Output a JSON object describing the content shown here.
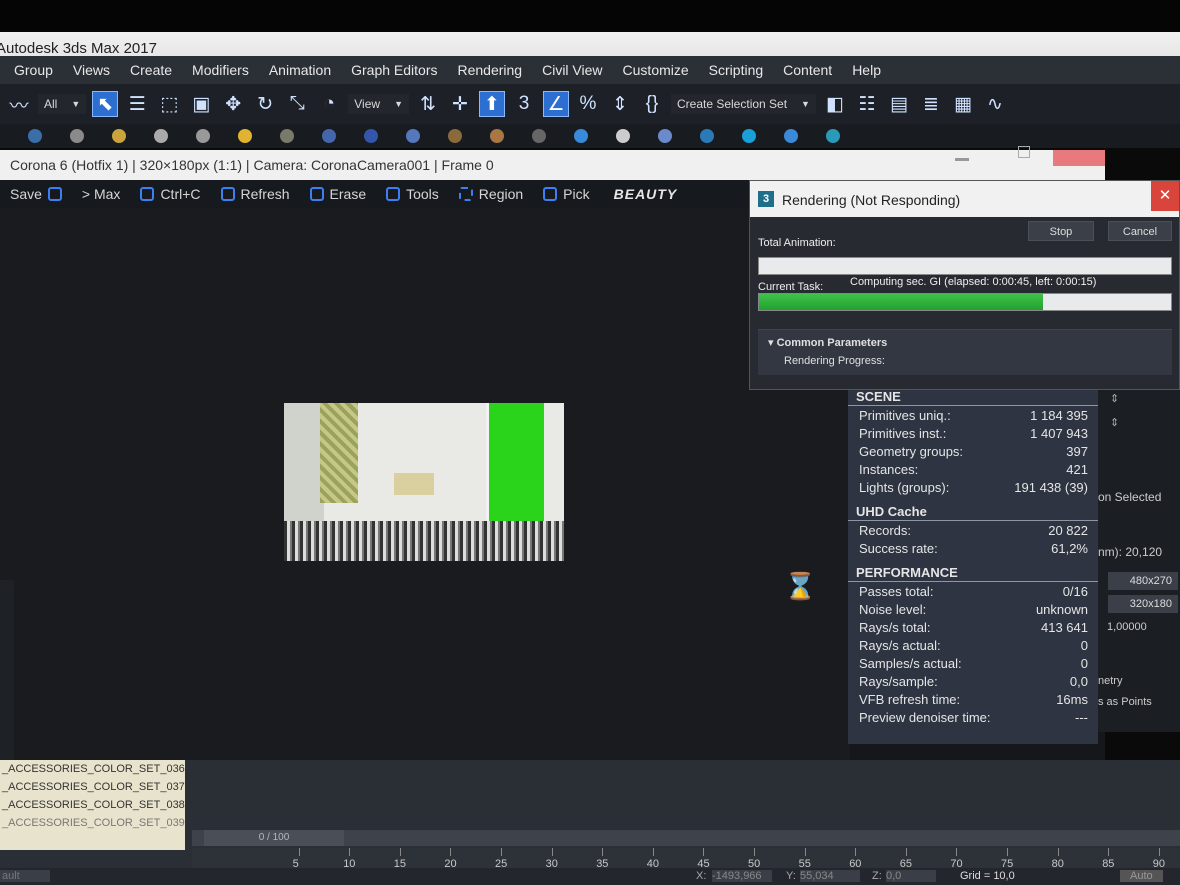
{
  "app": {
    "title": "Autodesk 3ds Max 2017"
  },
  "menu": [
    "Group",
    "Views",
    "Create",
    "Modifiers",
    "Animation",
    "Graph Editors",
    "Rendering",
    "Civil View",
    "Customize",
    "Scripting",
    "Content",
    "Help"
  ],
  "toolbar": {
    "filter": "All",
    "ref_coord": "View",
    "selection_set": "Create Selection Set"
  },
  "vfb": {
    "title": "Corona 6 (Hotfix 1) | 320×180px (1:1) | Camera: CoronaCamera001 | Frame 0",
    "buttons": {
      "save": "Save",
      "to_max": "> Max",
      "copy": "Ctrl+C",
      "refresh": "Refresh",
      "erase": "Erase",
      "tools": "Tools",
      "region": "Region",
      "pick": "Pick"
    },
    "pass": "BEAUTY"
  },
  "dialog": {
    "title": "Rendering (Not Responding)",
    "stop": "Stop",
    "cancel": "Cancel",
    "total_animation_label": "Total Animation:",
    "total_animation_progress": 0,
    "current_task_label": "Current Task:",
    "current_task": "Computing sec. GI (elapsed: 0:00:45, left: 0:00:15)",
    "current_task_progress": 0.69,
    "rollout_title": "Common Parameters",
    "rollout_content": "Rendering Progress:"
  },
  "stats": {
    "scene": {
      "title": "SCENE",
      "rows": [
        {
          "label": "Primitives uniq.:",
          "value": "1 184 395"
        },
        {
          "label": "Primitives inst.:",
          "value": "1 407 943"
        },
        {
          "label": "Geometry groups:",
          "value": "397"
        },
        {
          "label": "Instances:",
          "value": "421"
        },
        {
          "label": "Lights (groups):",
          "value": "191 438 (39)"
        }
      ]
    },
    "uhd": {
      "title": "UHD Cache",
      "rows": [
        {
          "label": "Records:",
          "value": "20 822"
        },
        {
          "label": "Success rate:",
          "value": "61,2%"
        }
      ]
    },
    "performance": {
      "title": "PERFORMANCE",
      "rows": [
        {
          "label": "Passes total:",
          "value": "0/16"
        },
        {
          "label": "Noise level:",
          "value": "unknown"
        },
        {
          "label": "Rays/s total:",
          "value": "413 641"
        },
        {
          "label": "Rays/s actual:",
          "value": "0"
        },
        {
          "label": "Samples/s actual:",
          "value": "0"
        },
        {
          "label": "Rays/sample:",
          "value": "0,0"
        },
        {
          "label": "VFB refresh time:",
          "value": "16ms"
        },
        {
          "label": "Preview denoiser time:",
          "value": "---"
        }
      ]
    }
  },
  "right_panel": {
    "selected": "on Selected",
    "aperture": "nm): 20,120",
    "res1": "480x270",
    "res2": "320x180",
    "aspect": "1,00000",
    "geometry": "netry",
    "points": "s as Points"
  },
  "scene_list": [
    "_ACCESSORIES_COLOR_SET_036",
    "_ACCESSORIES_COLOR_SET_037",
    "_ACCESSORIES_COLOR_SET_038",
    "_ACCESSORIES_COLOR_SET_039"
  ],
  "timeline": {
    "position": "0 / 100",
    "ticks": [
      "5",
      "10",
      "15",
      "20",
      "25",
      "30",
      "35",
      "40",
      "45",
      "50",
      "55",
      "60",
      "65",
      "70",
      "75",
      "80",
      "85",
      "90"
    ]
  },
  "status": {
    "layer": "ault",
    "x_label": "X:",
    "x": "-1493,966",
    "y_label": "Y:",
    "y": "55,034",
    "z_label": "Z:",
    "z": "0,0",
    "grid": "Grid = 10,0",
    "auto": "Auto"
  },
  "colors": {
    "accent": "#2d6fd1",
    "progress": "#2ab33a",
    "close": "#d9443b"
  }
}
